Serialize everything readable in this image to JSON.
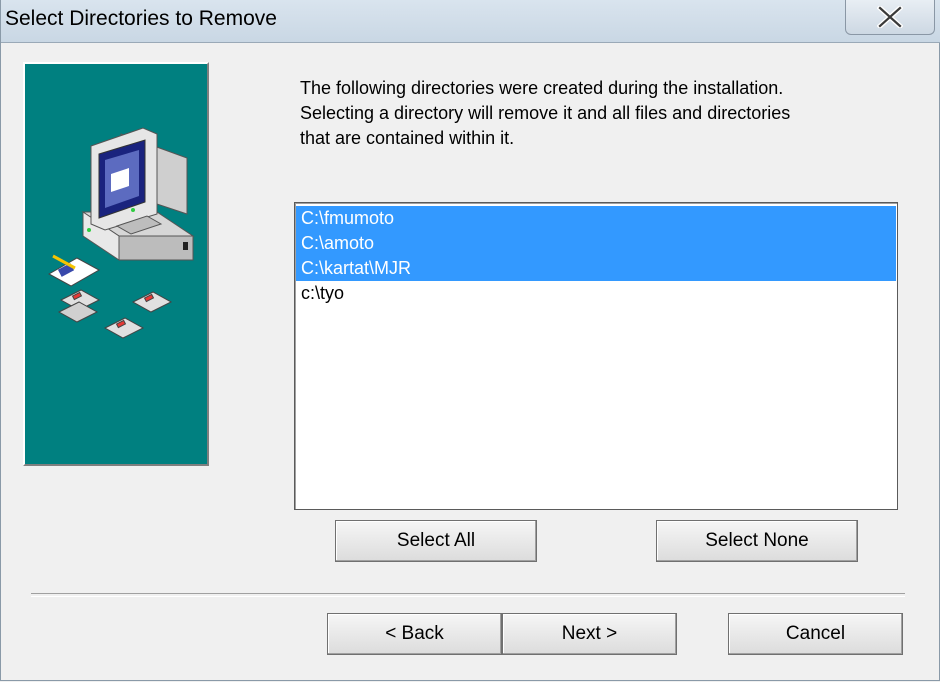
{
  "window": {
    "title": "Select Directories to Remove",
    "close_icon": "close-x-icon"
  },
  "side_panel": {
    "illustration": "computer-with-floppy-disks-icon",
    "background_color": "#008080"
  },
  "description": {
    "lines": [
      "The following directories were created during the installation.",
      "Selecting a directory will remove it and all files and directories",
      "that are contained within it."
    ]
  },
  "directory_list": {
    "items": [
      {
        "path": "C:\\fmumoto",
        "selected": true
      },
      {
        "path": "C:\\amoto",
        "selected": true
      },
      {
        "path": "C:\\kartat\\MJR",
        "selected": true
      },
      {
        "path": "c:\\tyo",
        "selected": false
      }
    ],
    "selection_color": "#3399ff"
  },
  "selection_buttons": {
    "select_all": "Select All",
    "select_none": "Select None"
  },
  "navigation": {
    "back": "< Back",
    "next": "Next >",
    "cancel": "Cancel"
  }
}
